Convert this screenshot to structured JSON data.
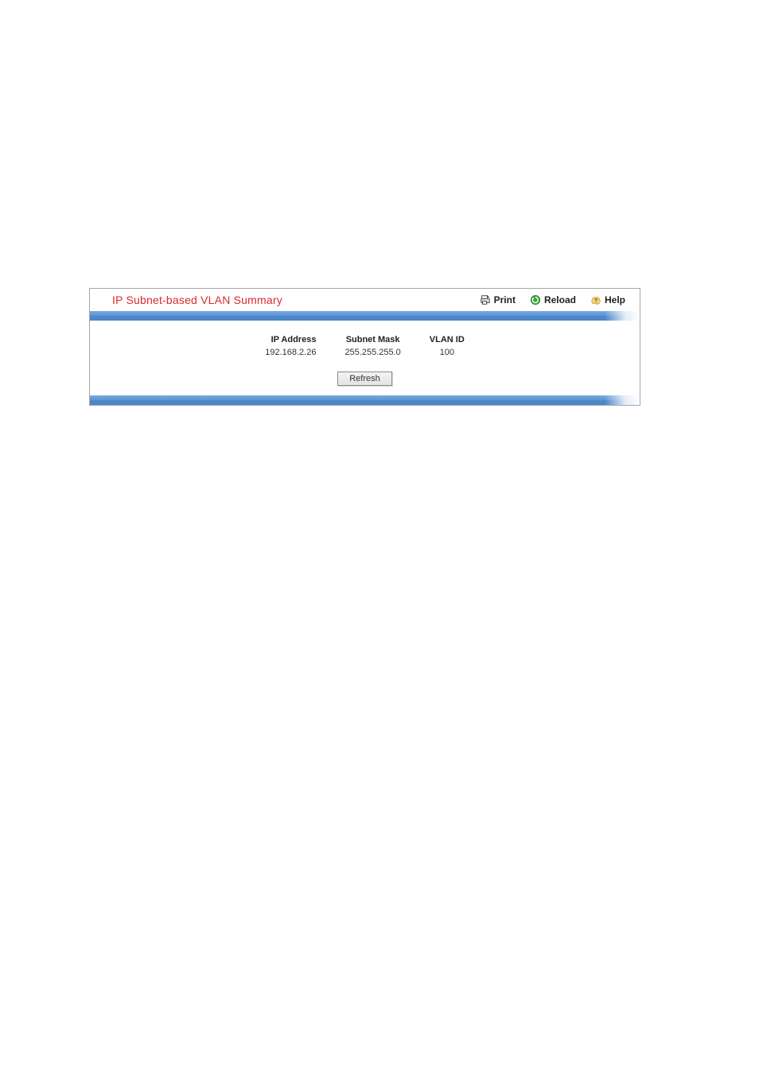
{
  "header": {
    "title": "IP Subnet-based VLAN Summary",
    "print_label": "Print",
    "reload_label": "Reload",
    "help_label": "Help"
  },
  "table": {
    "columns": {
      "ip": "IP Address",
      "mask": "Subnet Mask",
      "vlan": "VLAN ID"
    },
    "rows": [
      {
        "ip": "192.168.2.26",
        "mask": "255.255.255.0",
        "vlan": "100"
      }
    ]
  },
  "buttons": {
    "refresh": "Refresh"
  }
}
